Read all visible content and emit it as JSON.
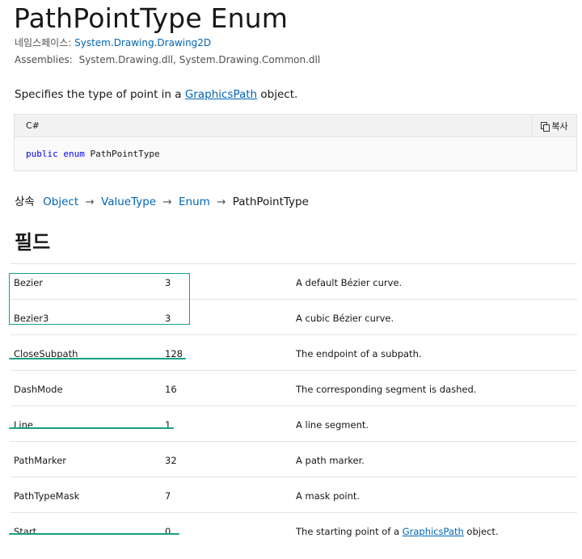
{
  "title": "PathPointType Enum",
  "namespace": {
    "label": "네임스페이스:",
    "value": "System.Drawing.Drawing2D"
  },
  "assemblies": {
    "label": "Assemblies:",
    "value": "System.Drawing.dll, System.Drawing.Common.dll"
  },
  "summary": {
    "before": "Specifies the type of point in a ",
    "link": "GraphicsPath",
    "after": " object."
  },
  "code": {
    "lang": "C#",
    "copy_label": "복사",
    "kw1": "public",
    "kw2": "enum",
    "name": "PathPointType"
  },
  "inheritance": {
    "label": "상속",
    "items": [
      "Object",
      "ValueType",
      "Enum"
    ],
    "current": "PathPointType",
    "arrow": "→"
  },
  "fields_heading": "필드",
  "fields": [
    {
      "name": "Bezier",
      "value": "3",
      "desc": "A default Bézier curve."
    },
    {
      "name": "Bezier3",
      "value": "3",
      "desc": "A cubic Bézier curve."
    },
    {
      "name": "CloseSubpath",
      "value": "128",
      "desc": "The endpoint of a subpath."
    },
    {
      "name": "DashMode",
      "value": "16",
      "desc": "The corresponding segment is dashed."
    },
    {
      "name": "Line",
      "value": "1",
      "desc": "A line segment."
    },
    {
      "name": "PathMarker",
      "value": "32",
      "desc": "A path marker."
    },
    {
      "name": "PathTypeMask",
      "value": "7",
      "desc": "A mask point."
    },
    {
      "name": "Start",
      "value": "0",
      "desc_before": "The starting point of a ",
      "desc_link": "GraphicsPath",
      "desc_after": " object."
    }
  ],
  "colors": {
    "link": "#0065b3",
    "annotation": "#16a085",
    "keyword": "#0101fd"
  }
}
